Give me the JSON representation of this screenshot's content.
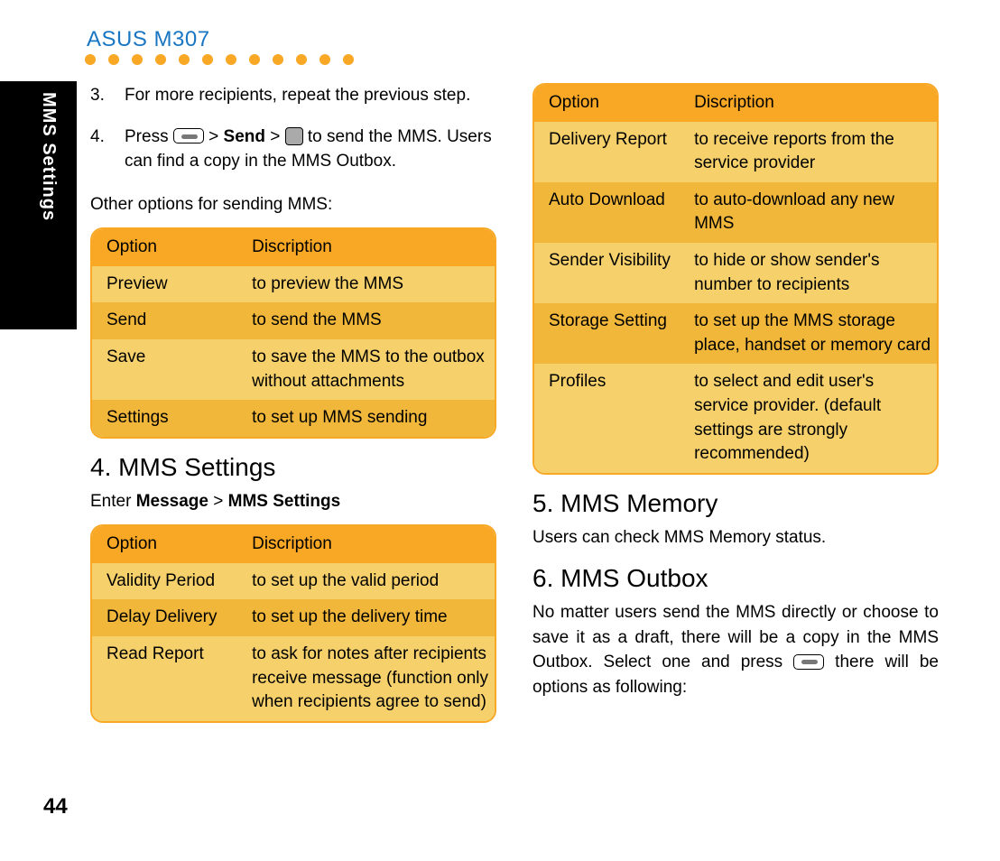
{
  "side_tab": "MMS Settings",
  "page_number": "44",
  "header_model": "ASUS M307",
  "steps": {
    "s3_num": "3.",
    "s3_txt": "For more recipients, repeat the previous step.",
    "s4_num": "4.",
    "s4_pre": "Press ",
    "s4_gt1": " > ",
    "s4_send": "Send",
    "s4_gt2": " > ",
    "s4_post": " to send the MMS. Users can find a copy in the MMS Outbox."
  },
  "other_options_label": "Other options for sending MMS:",
  "table1": {
    "h1": "Option",
    "h2": "Discription",
    "rows": [
      {
        "c1": "Preview",
        "c2": "to preview the MMS"
      },
      {
        "c1": "Send",
        "c2": "to send the MMS"
      },
      {
        "c1": "Save",
        "c2": "to save the MMS to the outbox without attachments"
      },
      {
        "c1": "Settings",
        "c2": "to set up MMS sending"
      }
    ]
  },
  "sec4_title": "4. MMS Settings",
  "sec4_enter_pre": "Enter ",
  "sec4_enter_b1": "Message",
  "sec4_enter_mid": " > ",
  "sec4_enter_b2": "MMS Settings",
  "table2": {
    "h1": "Option",
    "h2": "Discription",
    "rows": [
      {
        "c1": "Validity Period",
        "c2": "to set up the valid period"
      },
      {
        "c1": "Delay Delivery",
        "c2": "to set up the delivery time"
      },
      {
        "c1": "Read Report",
        "c2": "to ask for notes after recipients receive message (function only when recipients agree to send)"
      }
    ]
  },
  "table3": {
    "h1": "Option",
    "h2": "Discription",
    "rows": [
      {
        "c1": "Delivery Report",
        "c2": "to receive reports from the service provider"
      },
      {
        "c1": "Auto Download",
        "c2": "to auto-download any new MMS"
      },
      {
        "c1": "Sender Visibility",
        "c2": "to hide or show sender's number to recipients"
      },
      {
        "c1": "Storage Setting",
        "c2": "to set up the MMS storage place, handset or memory card"
      },
      {
        "c1": "Profiles",
        "c2": "to select and edit user's service provider. (default settings are strongly recommended)"
      }
    ]
  },
  "sec5_title": "5. MMS Memory",
  "sec5_body": "Users can check MMS Memory status.",
  "sec6_title": "6. MMS Outbox",
  "sec6_body_pre": "No matter users send the MMS directly or choose to save it as a draft, there will be a copy in the MMS Outbox. Select one and press ",
  "sec6_body_post": " there will be options as following:"
}
